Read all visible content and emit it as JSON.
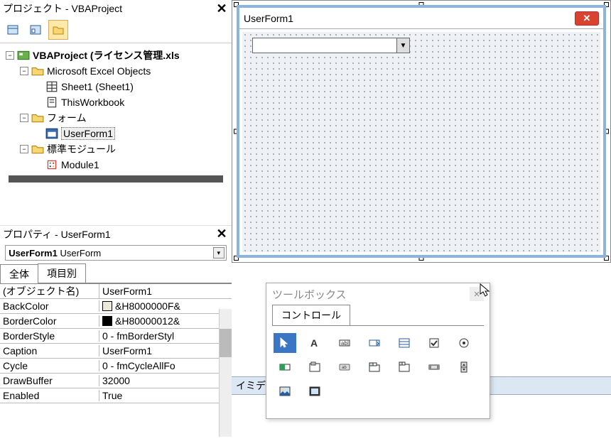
{
  "project_panel": {
    "title": "プロジェクト - VBAProject",
    "root": "VBAProject (ライセンス管理.xls",
    "folders": {
      "excel_objects": "Microsoft Excel Objects",
      "sheet1": "Sheet1 (Sheet1)",
      "this_workbook": "ThisWorkbook",
      "forms": "フォーム",
      "userform1": "UserForm1",
      "std_modules": "標準モジュール",
      "module1": "Module1"
    }
  },
  "properties_panel": {
    "title": "プロパティ - UserForm1",
    "object_selector_name": "UserForm1",
    "object_selector_type": "UserForm",
    "tabs": {
      "all": "全体",
      "by_category": "項目別"
    },
    "rows": [
      {
        "name": "(オブジェクト名)",
        "value": "UserForm1"
      },
      {
        "name": "BackColor",
        "value": "&H8000000F&",
        "swatch": "#ece9d8"
      },
      {
        "name": "BorderColor",
        "value": "&H80000012&",
        "swatch": "#000000"
      },
      {
        "name": "BorderStyle",
        "value": "0 - fmBorderStyl"
      },
      {
        "name": "Caption",
        "value": "UserForm1"
      },
      {
        "name": "Cycle",
        "value": "0 - fmCycleAllFo"
      },
      {
        "name": "DrawBuffer",
        "value": "32000"
      },
      {
        "name": "Enabled",
        "value": "True"
      }
    ]
  },
  "form_designer": {
    "caption": "UserForm1"
  },
  "toolbox": {
    "title": "ツールボックス",
    "tab": "コントロール",
    "tools": [
      "pointer",
      "label",
      "textbox",
      "combobox",
      "listbox",
      "checkbox",
      "optionbutton",
      "togglebutton",
      "frame",
      "commandbutton",
      "tabstrip",
      "multipage",
      "scrollbar",
      "spinbutton",
      "image",
      "refedit"
    ]
  },
  "immediate": {
    "label": "イミディエ"
  }
}
